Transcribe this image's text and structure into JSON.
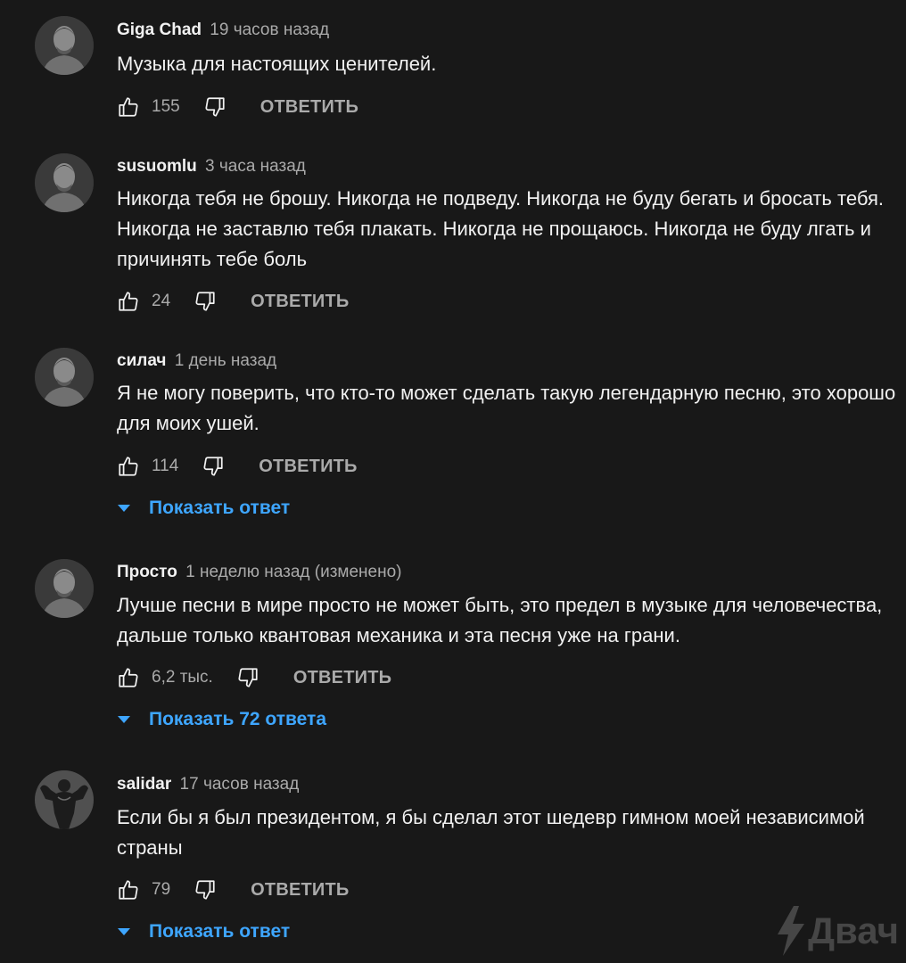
{
  "comments": [
    {
      "author": "Giga Chad",
      "time": "19 часов назад",
      "text": "Музыка для настоящих ценителей.",
      "likes": "155",
      "reply_label": "ОТВЕТИТЬ",
      "avatar_icon": "portrait-avatar-icon"
    },
    {
      "author": "susuomlu",
      "time": "3 часа назад",
      "text": "Никогда тебя не брошу. Никогда не подведу. Никогда не буду бегать и бросать тебя. Никогда не заставлю тебя плакать. Никогда не прощаюсь. Никогда не буду лгать и причинять тебе боль",
      "likes": "24",
      "reply_label": "ОТВЕТИТЬ",
      "avatar_icon": "portrait-avatar-icon"
    },
    {
      "author": "силач",
      "time": "1 день назад",
      "text": "Я не могу поверить, что кто-то может сделать такую легендарную песню, это хорошо для моих ушей.",
      "likes": "114",
      "reply_label": "ОТВЕТИТЬ",
      "show_replies": "Показать ответ",
      "avatar_icon": "portrait-avatar-icon"
    },
    {
      "author": "Просто",
      "time": "1 неделю назад (изменено)",
      "text": "Лучше песни в мире просто не может быть, это предел в музыке для человечества, дальше только квантовая механика и эта песня уже на грани.",
      "likes": "6,2 тыс.",
      "reply_label": "ОТВЕТИТЬ",
      "show_replies": "Показать 72 ответа",
      "avatar_icon": "portrait-avatar-icon"
    },
    {
      "author": "salidar",
      "time": "17 часов назад",
      "text": "Если бы я был президентом, я бы сделал этот шедевр гимном моей независимой страны",
      "likes": "79",
      "reply_label": "ОТВЕТИТЬ",
      "show_replies": "Показать ответ",
      "avatar_icon": "bodybuilder-avatar-icon"
    }
  ],
  "watermark": {
    "text": "Двач",
    "icon": "lightning-icon"
  },
  "colors": {
    "background": "#181818",
    "primary_text": "#f1f1f1",
    "secondary_text": "#aaaaaa",
    "link_blue": "#3ea6ff"
  }
}
